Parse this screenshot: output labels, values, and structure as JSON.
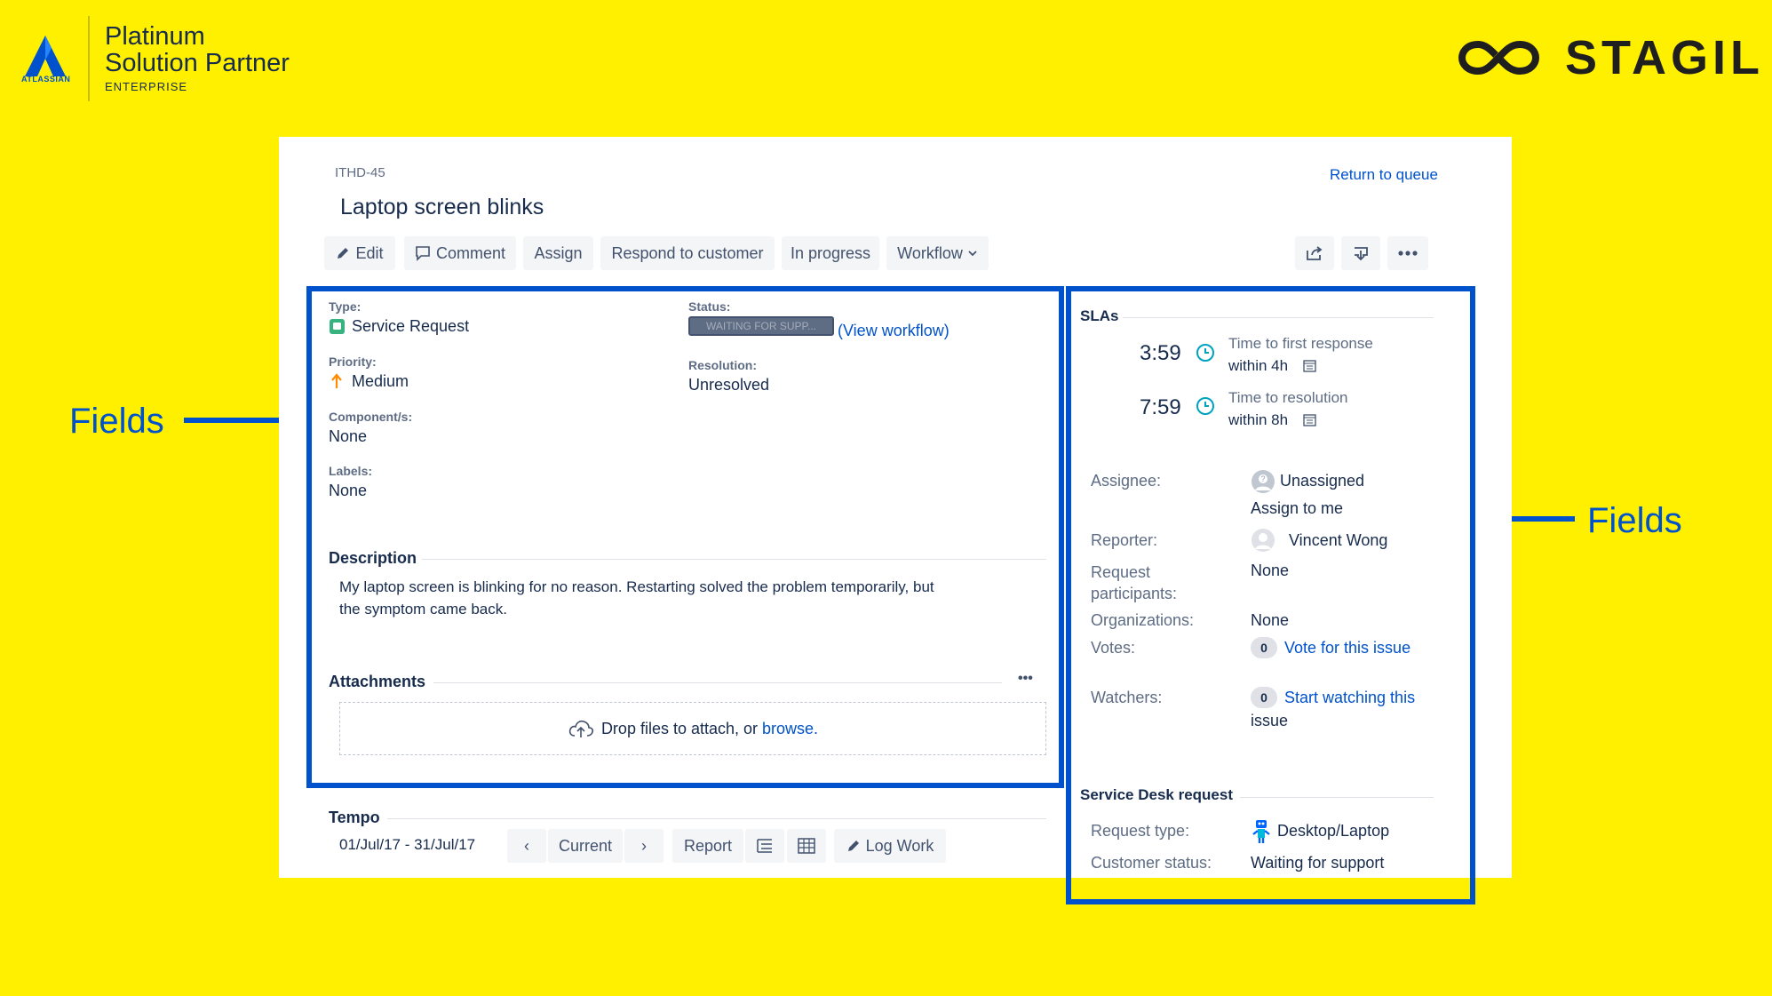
{
  "branding": {
    "atlassian_word": "ATLASSIAN",
    "partner_line1": "Platinum",
    "partner_line2": "Solution Partner",
    "partner_tier": "ENTERPRISE",
    "stagil_word": "STAGIL",
    "colors": {
      "background": "#FFF000",
      "accent": "#0052CC"
    }
  },
  "annotations": {
    "left_label": "Fields",
    "right_label": "Fields"
  },
  "issue": {
    "key": "ITHD-45",
    "title": "Laptop screen blinks",
    "return_link": "Return to queue"
  },
  "toolbar": {
    "edit": "Edit",
    "comment": "Comment",
    "assign": "Assign",
    "respond": "Respond to customer",
    "in_progress": "In progress",
    "workflow": "Workflow",
    "share_icon": "share-icon",
    "export_icon": "export-icon",
    "more_icon": "more-icon"
  },
  "details": {
    "type_label": "Type:",
    "type_value": "Service Request",
    "status_label": "Status:",
    "status_value": "WAITING FOR SUPP...",
    "view_workflow_open": "(",
    "view_workflow": "View workflow",
    "view_workflow_close": ")",
    "priority_label": "Priority:",
    "priority_value": "Medium",
    "resolution_label": "Resolution:",
    "resolution_value": "Unresolved",
    "components_label": "Component/s:",
    "components_value": "None",
    "labels_label": "Labels:",
    "labels_value": "None"
  },
  "description": {
    "title": "Description",
    "line1": "My laptop screen is blinking for no reason. Restarting solved the problem temporarily, but",
    "line2": "the symptom came back."
  },
  "attachments": {
    "title": "Attachments",
    "more": "•••",
    "drop_text": "Drop files to attach, or ",
    "browse": "browse."
  },
  "tempo": {
    "title": "Tempo",
    "range": "01/Jul/17 - 31/Jul/17",
    "prev": "‹",
    "current": "Current",
    "next": "›",
    "report": "Report",
    "log_work": "Log Work"
  },
  "slas": {
    "title": "SLAs",
    "items": [
      {
        "time": "3:59",
        "name": "Time to first response",
        "within": "within 4h"
      },
      {
        "time": "7:59",
        "name": "Time to resolution",
        "within": "within 8h"
      }
    ]
  },
  "people": {
    "assignee_label": "Assignee:",
    "assignee_value": "Unassigned",
    "assign_to_me": "Assign to me",
    "reporter_label": "Reporter:",
    "reporter_value": "Vincent Wong",
    "participants_label1": "Request",
    "participants_label2": "participants:",
    "participants_value": "None",
    "orgs_label": "Organizations:",
    "orgs_value": "None",
    "votes_label": "Votes:",
    "votes_count": "0",
    "votes_link": "Vote for this issue",
    "watchers_label": "Watchers:",
    "watchers_count": "0",
    "watchers_link1": "Start watching this",
    "watchers_link2": "issue"
  },
  "service_desk": {
    "title": "Service Desk request",
    "request_type_label": "Request type:",
    "request_type_value": "Desktop/Laptop",
    "customer_status_label": "Customer status:",
    "customer_status_value": "Waiting for support"
  }
}
